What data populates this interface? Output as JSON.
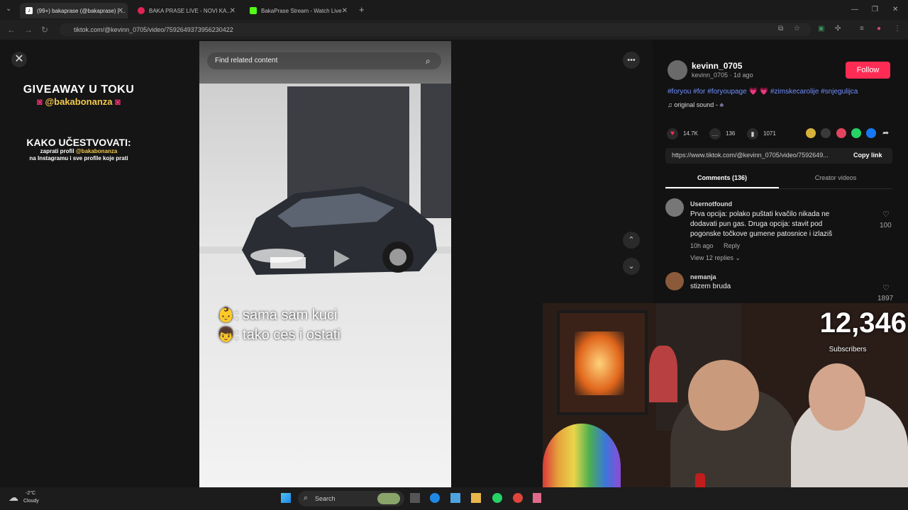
{
  "tabs": [
    {
      "title": "(99+) bakaprase (@bakaprase) | ...",
      "color": "#111111",
      "active": true
    },
    {
      "title": "BAKA PRASE LIVE - NOVI KA...",
      "color": "#e02454",
      "active": false
    },
    {
      "title": "BakaPrase Stream - Watch Live",
      "color": "#53fc18",
      "active": false
    }
  ],
  "address": {
    "url": "tiktok.com/@kevinn_0705/video/7592649373956230422"
  },
  "overlay": {
    "giveaway_line1": "GIVEAWAY U TOKU",
    "giveaway_handle": "@bakabonanza",
    "kako": "KAKO UČESTVOVATI:",
    "instr_prefix": "zaprati profil",
    "instr_handle": "@bakabonanza",
    "instr_line2": "na Instagramu i sve profile koje prati"
  },
  "video": {
    "search_placeholder": "Find related content",
    "caption_line1": ": sama sam kuci",
    "caption_line2": ": tako ces i ostati",
    "caption_emoji1": "👶",
    "caption_emoji2": "👦"
  },
  "author": {
    "username": "kevinn_0705",
    "subline": "kevinn_0705 · 1d ago",
    "follow_label": "Follow",
    "hashtags": "#foryou #for #foryoupage 💗 💗 #zimskecarolije #snjegulijca",
    "sound": "original sound -"
  },
  "actions": {
    "likes": "14.7K",
    "comments": "136",
    "saves": "1071"
  },
  "link": {
    "url": "https://www.tiktok.com/@kevinn_0705/video/7592649...",
    "copy_label": "Copy link"
  },
  "panel_tabs": {
    "comments": "Comments (136)",
    "creator": "Creator videos"
  },
  "comments": [
    {
      "user": "Usernotfound",
      "text": "Prva opcija: polako puštati kvačilo nikada ne dodavati pun gas. Druga opcija: stavit pod pogonske točkove gumene patosnice i izlaziš",
      "time": "10h ago",
      "reply": "Reply",
      "likes": "100",
      "view_replies": "View 12 replies"
    },
    {
      "user": "nemanja",
      "text": "stizem bruda",
      "likes": "1897"
    }
  ],
  "stream": {
    "subscribers_count": "12,346",
    "subscribers_label": "Subscribers"
  },
  "taskbar": {
    "temp": "-2°C",
    "weather": "Cloudy",
    "search": "Search"
  },
  "colors": {
    "accent": "#fe2c55",
    "hashtag": "#6f8fff",
    "handle": "#f2c94c"
  }
}
